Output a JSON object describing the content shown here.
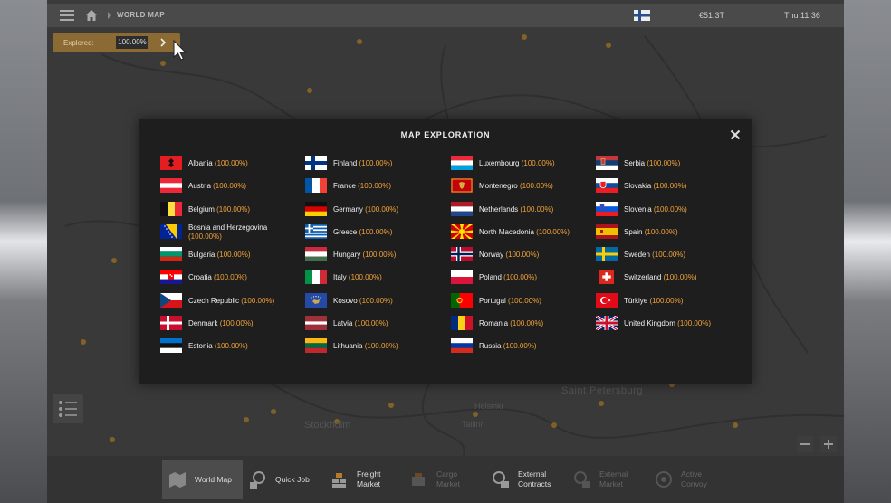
{
  "topbar": {
    "breadcrumb": "WORLD MAP",
    "money": "€51.3T",
    "clock": "Thu 11:36"
  },
  "explored": {
    "label": "Explored:",
    "value": "100.00%"
  },
  "modal": {
    "title": "MAP EXPLORATION",
    "columns": [
      [
        {
          "country": "Albania",
          "pct": "(100.00%)",
          "flag": "albania"
        },
        {
          "country": "Austria",
          "pct": "(100.00%)",
          "flag": "austria"
        },
        {
          "country": "Belgium",
          "pct": "(100.00%)",
          "flag": "belgium"
        },
        {
          "country": "Bosnia and Herzegovina",
          "pct": "(100.00%)",
          "flag": "bosnia"
        },
        {
          "country": "Bulgaria",
          "pct": "(100.00%)",
          "flag": "bulgaria"
        },
        {
          "country": "Croatia",
          "pct": "(100.00%)",
          "flag": "croatia"
        },
        {
          "country": "Czech Republic",
          "pct": "(100.00%)",
          "flag": "czech"
        },
        {
          "country": "Denmark",
          "pct": "(100.00%)",
          "flag": "denmark"
        },
        {
          "country": "Estonia",
          "pct": "(100.00%)",
          "flag": "estonia"
        }
      ],
      [
        {
          "country": "Finland",
          "pct": "(100.00%)",
          "flag": "finland"
        },
        {
          "country": "France",
          "pct": "(100.00%)",
          "flag": "france"
        },
        {
          "country": "Germany",
          "pct": "(100.00%)",
          "flag": "germany"
        },
        {
          "country": "Greece",
          "pct": "(100.00%)",
          "flag": "greece"
        },
        {
          "country": "Hungary",
          "pct": "(100.00%)",
          "flag": "hungary"
        },
        {
          "country": "Italy",
          "pct": "(100.00%)",
          "flag": "italy"
        },
        {
          "country": "Kosovo",
          "pct": "(100.00%)",
          "flag": "kosovo"
        },
        {
          "country": "Latvia",
          "pct": "(100.00%)",
          "flag": "latvia"
        },
        {
          "country": "Lithuania",
          "pct": "(100.00%)",
          "flag": "lithuania"
        }
      ],
      [
        {
          "country": "Luxembourg",
          "pct": "(100.00%)",
          "flag": "luxembourg"
        },
        {
          "country": "Montenegro",
          "pct": "(100.00%)",
          "flag": "montenegro"
        },
        {
          "country": "Netherlands",
          "pct": "(100.00%)",
          "flag": "netherlands"
        },
        {
          "country": "North Macedonia",
          "pct": "(100.00%)",
          "flag": "macedonia"
        },
        {
          "country": "Norway",
          "pct": "(100.00%)",
          "flag": "norway"
        },
        {
          "country": "Poland",
          "pct": "(100.00%)",
          "flag": "poland"
        },
        {
          "country": "Portugal",
          "pct": "(100.00%)",
          "flag": "portugal"
        },
        {
          "country": "Romania",
          "pct": "(100.00%)",
          "flag": "romania"
        },
        {
          "country": "Russia",
          "pct": "(100.00%)",
          "flag": "russia"
        }
      ],
      [
        {
          "country": "Serbia",
          "pct": "(100.00%)",
          "flag": "serbia"
        },
        {
          "country": "Slovakia",
          "pct": "(100.00%)",
          "flag": "slovakia"
        },
        {
          "country": "Slovenia",
          "pct": "(100.00%)",
          "flag": "slovenia"
        },
        {
          "country": "Spain",
          "pct": "(100.00%)",
          "flag": "spain"
        },
        {
          "country": "Sweden",
          "pct": "(100.00%)",
          "flag": "sweden"
        },
        {
          "country": "Switzerland",
          "pct": "(100.00%)",
          "flag": "switzerland"
        },
        {
          "country": "Türkiye",
          "pct": "(100.00%)",
          "flag": "turkiye"
        },
        {
          "country": "United Kingdom",
          "pct": "(100.00%)",
          "flag": "uk"
        }
      ]
    ]
  },
  "map_labels": [
    "Saint Petersburg",
    "Stockholm",
    "Helsinki",
    "Tallinn"
  ],
  "bottom": {
    "tabs": [
      {
        "label": "World Map",
        "icon": "world-map-icon",
        "state": "active"
      },
      {
        "label": "Quick Job",
        "icon": "quick-job-icon",
        "state": "normal"
      },
      {
        "label": "Freight Market",
        "icon": "freight-market-icon",
        "state": "normal"
      },
      {
        "label": "Cargo Market",
        "icon": "cargo-market-icon",
        "state": "disabled"
      },
      {
        "label": "External Contracts",
        "icon": "external-contracts-icon",
        "state": "normal"
      },
      {
        "label": "External Market",
        "icon": "external-market-icon",
        "state": "disabled"
      },
      {
        "label": "Active Convoy",
        "icon": "active-convoy-icon",
        "state": "disabled"
      }
    ]
  },
  "colors": {
    "accent": "#f2a33a",
    "explored_bg": "#8b6a33",
    "modal_bg": "#1e1e1e"
  }
}
